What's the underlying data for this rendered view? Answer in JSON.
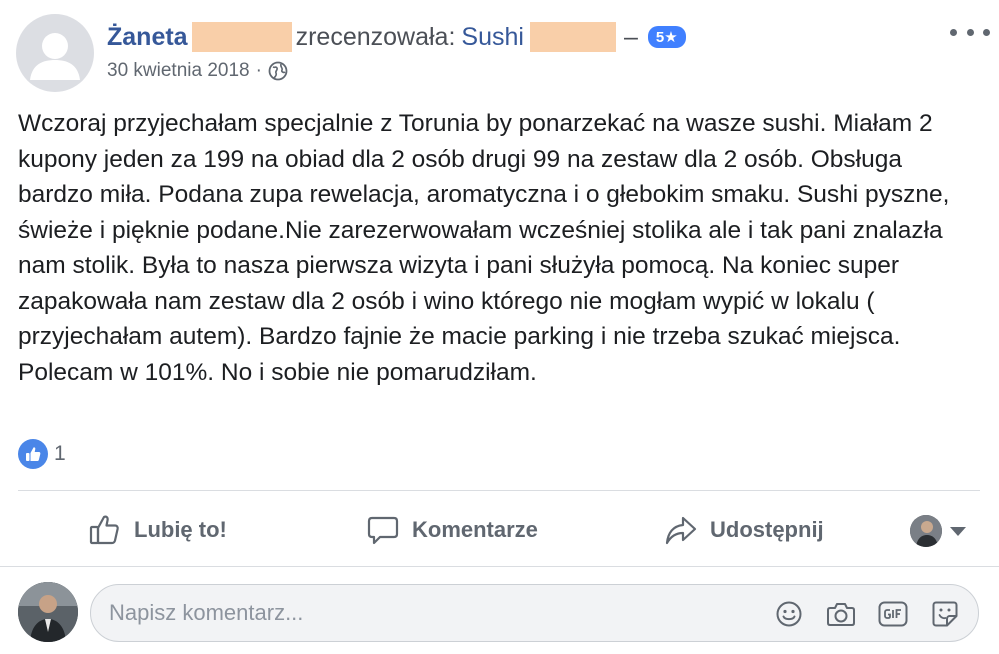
{
  "post": {
    "author_name": "Żaneta",
    "reviewed_text": "zrecenzowała:",
    "page_name": "Sushi",
    "dash": "–",
    "rating": "5★",
    "date": "30 kwietnia 2018",
    "meta_separator": "·",
    "review_text": "Wczoraj przyjechałam specjalnie z Torunia by ponarzekać na wasze sushi. Miałam 2 kupony jeden za 199 na obiad dla 2 osób drugi 99 na zestaw dla 2 osób. Obsługa bardzo miła. Podana zupa rewelacja, aromatyczna i o głebokim smaku. Sushi pyszne, świeże i pięknie podane.Nie zarezerwowałam wcześniej stolika ale i tak pani znalazła nam stolik. Była to nasza pierwsza wizyta i pani służyła pomocą. Na koniec super zapakowała nam zestaw dla 2 osób i wino którego nie mogłam wypić w lokalu ( przyjechałam autem). Bardzo fajnie że macie parking i nie trzeba szukać miejsca. Polecam w 101%. No i sobie nie pomarudziłam.",
    "like_count": "1"
  },
  "actions": {
    "like_label": "Lubię to!",
    "comment_label": "Komentarze",
    "share_label": "Udostępnij"
  },
  "composer": {
    "placeholder": "Napisz komentarz..."
  },
  "icons": {
    "like_bubble": "thumbs-up-icon",
    "globe": "globe-icon",
    "more": "more-options-icon",
    "emoji": "emoji-icon",
    "camera": "camera-icon",
    "gif": "gif-icon",
    "sticker": "sticker-icon"
  },
  "colors": {
    "link_blue": "#365899",
    "rating_blue": "#4080ff",
    "redaction": "#f9cfa9",
    "muted": "#606770"
  }
}
